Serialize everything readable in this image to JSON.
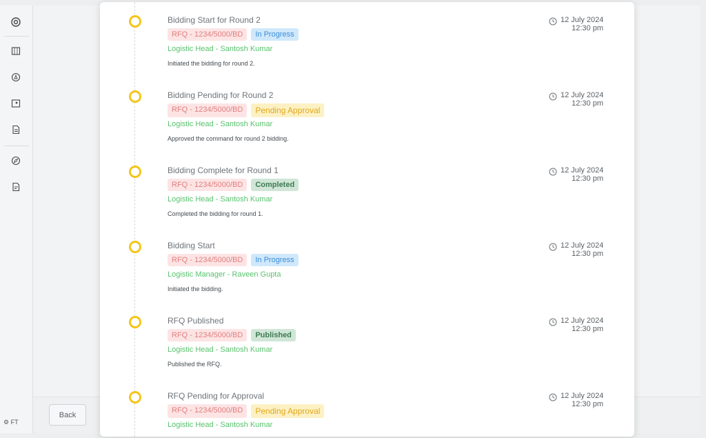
{
  "sidebar": {
    "footer": "⚙ FT",
    "icons": [
      "logo-icon",
      "map-icon",
      "location-icon",
      "map-pin-icon",
      "document-icon",
      "compass-icon",
      "report-icon"
    ]
  },
  "footer": {
    "back_label": "Back"
  },
  "timeline": [
    {
      "title": "Bidding Start for Round 2",
      "rfq": "RFQ - 1234/5000/BD",
      "status": "In Progress",
      "status_type": "progress",
      "person": "Logistic Head - Santosh Kumar",
      "description": "Initiated the bidding for round 2.",
      "date": "12 July 2024",
      "time": "12:30 pm"
    },
    {
      "title": "Bidding Pending for Round 2",
      "rfq": "RFQ - 1234/5000/BD",
      "status": "Pending Approval",
      "status_type": "pending",
      "person": "Logistic Head - Santosh Kumar",
      "description": "Approved the command for round 2 bidding.",
      "date": "12 July 2024",
      "time": "12:30 pm"
    },
    {
      "title": "Bidding Complete for Round 1",
      "rfq": "RFQ - 1234/5000/BD",
      "status": "Completed",
      "status_type": "completed",
      "person": "Logistic Head - Santosh Kumar",
      "description": "Completed the bidding for round 1.",
      "date": "12 July 2024",
      "time": "12:30 pm"
    },
    {
      "title": "Bidding Start",
      "rfq": "RFQ - 1234/5000/BD",
      "status": "In Progress",
      "status_type": "progress",
      "person": "Logistic Manager - Raveen Gupta",
      "description": "Initiated the bidding.",
      "date": "12 July 2024",
      "time": "12:30 pm"
    },
    {
      "title": "RFQ Published",
      "rfq": "RFQ - 1234/5000/BD",
      "status": "Published",
      "status_type": "published",
      "person": "Logistic Head - Santosh Kumar",
      "description": "Published the RFQ.",
      "date": "12 July 2024",
      "time": "12:30 pm"
    },
    {
      "title": "RFQ Pending for Approval",
      "rfq": "RFQ - 1234/5000/BD",
      "status": "Pending Approval",
      "status_type": "pending",
      "person": "Logistic Head - Santosh Kumar",
      "description": "",
      "date": "12 July 2024",
      "time": "12:30 pm"
    }
  ],
  "colors": {
    "dot": "#f5c518",
    "person": "#57c26c",
    "rfq_bg": "#fde4e4"
  }
}
